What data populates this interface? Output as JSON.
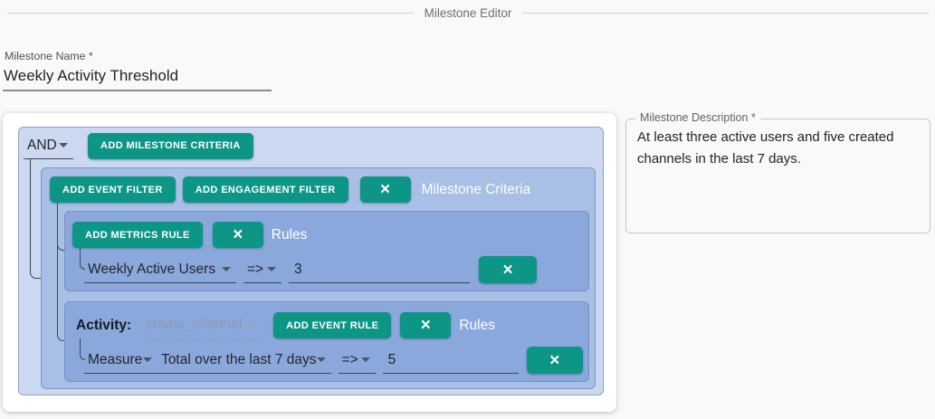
{
  "page": {
    "title": "Milestone Editor"
  },
  "name_field": {
    "label": "Milestone Name *",
    "value": "Weekly Activity Threshold"
  },
  "description_field": {
    "label": "Milestone Description *",
    "value": "At least three active users and five created channels in the last 7 days."
  },
  "icons": {
    "close": "×"
  },
  "builder": {
    "combinator": {
      "value": "AND"
    },
    "add_milestone_criteria_label": "ADD MILESTONE CRITERIA",
    "criteria_group": {
      "add_event_filter_label": "ADD EVENT FILTER",
      "add_engagement_filter_label": "ADD ENGAGEMENT FILTER",
      "title": "Milestone Criteria",
      "metrics_rules": {
        "add_metrics_rule_label": "ADD METRICS RULE",
        "title": "Rules",
        "rule": {
          "metric": "Weekly Active Users",
          "operator": "=>",
          "value": "3"
        }
      },
      "event_rules": {
        "activity_label": "Activity:",
        "activity_value": "create_channel",
        "add_event_rule_label": "ADD EVENT RULE",
        "title": "Rules",
        "rule": {
          "measure": "Measure",
          "aggregation": "Total over the last 7 days",
          "operator": "=>",
          "value": "5"
        }
      }
    }
  },
  "colors": {
    "accent_teal": "#0d9685",
    "panel_outer": "#ccd8f0",
    "panel_mid": "#a8bfe6",
    "panel_rules": "#8ba8dc",
    "page_background": "#f8f9f9"
  }
}
